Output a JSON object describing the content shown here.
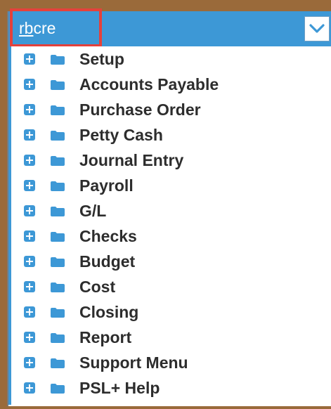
{
  "header": {
    "company_code_prefix": "rb",
    "company_code_suffix": "cre",
    "dropdown_icon": "chevron-down-icon"
  },
  "colors": {
    "frame": "#9a6a3a",
    "header_blue": "#3d98d6",
    "highlight_red": "#e4413b",
    "text_dark": "#2d2d2d"
  },
  "menu": {
    "items": [
      {
        "label": "Setup"
      },
      {
        "label": "Accounts Payable"
      },
      {
        "label": "Purchase Order"
      },
      {
        "label": "Petty Cash"
      },
      {
        "label": "Journal Entry"
      },
      {
        "label": "Payroll"
      },
      {
        "label": "G/L"
      },
      {
        "label": "Checks"
      },
      {
        "label": "Budget"
      },
      {
        "label": "Cost"
      },
      {
        "label": "Closing"
      },
      {
        "label": "Report"
      },
      {
        "label": "Support Menu"
      },
      {
        "label": "PSL+ Help"
      }
    ],
    "expander_icon": "plus-square-icon",
    "folder_icon": "folder-icon"
  }
}
